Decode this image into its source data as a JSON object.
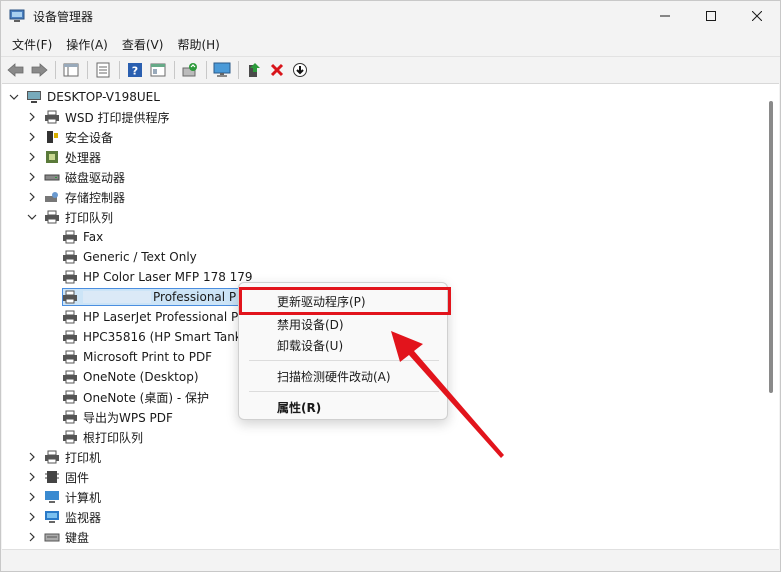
{
  "window": {
    "title": "设备管理器"
  },
  "menubar": [
    "文件(F)",
    "操作(A)",
    "查看(V)",
    "帮助(H)"
  ],
  "toolbar": {
    "buttons": [
      "back",
      "forward",
      "console-tree",
      "properties",
      "help",
      "view",
      "scan-hardware",
      "monitor",
      "update-driver",
      "uninstall",
      "disable"
    ]
  },
  "tree": {
    "root": "DESKTOP-V198UEL",
    "categories_top": [
      {
        "label": "WSD 打印提供程序",
        "icon": "printer-icon"
      },
      {
        "label": "安全设备",
        "icon": "security-device-icon"
      },
      {
        "label": "处理器",
        "icon": "processor-icon"
      },
      {
        "label": "磁盘驱动器",
        "icon": "disk-drive-icon"
      },
      {
        "label": "存储控制器",
        "icon": "storage-controller-icon"
      }
    ],
    "expanded": {
      "label": "打印队列",
      "children": [
        "Fax",
        "Generic / Text Only",
        "HP Color Laser MFP 178 179",
        "Professional P",
        "HP LaserJet Professional P",
        "HPC35816 (HP Smart Tank",
        "Microsoft Print to PDF",
        "OneNote (Desktop)",
        "OneNote (桌面) - 保护",
        "导出为WPS PDF",
        "根打印队列"
      ]
    },
    "categories_bottom": [
      {
        "label": "打印机",
        "icon": "printer-icon"
      },
      {
        "label": "固件",
        "icon": "firmware-icon"
      },
      {
        "label": "计算机",
        "icon": "computer-icon"
      },
      {
        "label": "监视器",
        "icon": "monitor-icon"
      },
      {
        "label": "键盘",
        "icon": "keyboard-icon"
      }
    ]
  },
  "context_menu": {
    "items": [
      "更新驱动程序(P)",
      "禁用设备(D)",
      "卸载设备(U)",
      "扫描检测硬件改动(A)",
      "属性(R)"
    ]
  },
  "colors": {
    "highlight": "#e2141c",
    "selection": "#cce4f7",
    "accent": "#0a64c8"
  }
}
